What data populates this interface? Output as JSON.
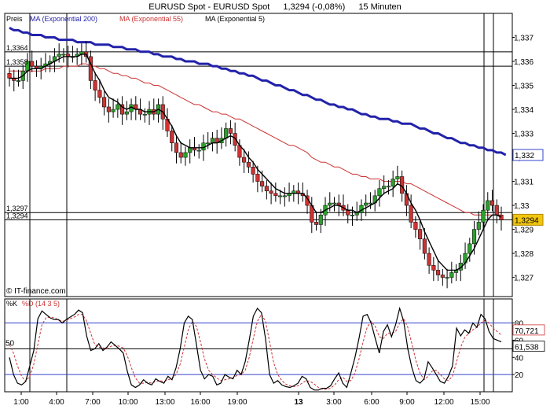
{
  "header": {
    "instrument": "EURUSD Spot - EURUSD Spot",
    "quote": "1,3294 (-0,08%)",
    "interval": "15 Minuten"
  },
  "chart_data": [
    {
      "type": "candlestick",
      "legend": [
        {
          "label": "Preis",
          "color": "#000000"
        },
        {
          "label": "MA (Exponential 200)",
          "color": "#2222aa"
        },
        {
          "label": "MA (Exponential 55)",
          "color": "#cc3333"
        },
        {
          "label": "MA (Exponential 5)",
          "color": "#000000"
        }
      ],
      "watermark": "© IT-finance.com",
      "ylim": [
        1.3262,
        1.338
      ],
      "y_ticks": [
        "1,337",
        "1,336",
        "1,335",
        "1,334",
        "1,333",
        "1,332",
        "1,331",
        "1,33",
        "1,329",
        "1,328",
        "1,327"
      ],
      "x_ticks": [
        "1:00",
        "4:00",
        "7:00",
        "10:00",
        "13:00",
        "16:00",
        "19:00",
        "13",
        "3:00",
        "6:00",
        "9:00",
        "12:00",
        "15:00"
      ],
      "h_levels": [
        {
          "label": "1,3364",
          "value": 1.3364
        },
        {
          "label": "1,3358",
          "value": 1.3358
        },
        {
          "label": "1,3297",
          "value": 1.3297
        },
        {
          "label": "1,3294",
          "value": 1.3294
        }
      ],
      "price_badges": [
        {
          "label": "1,332",
          "value": 1.3321,
          "style": "outline"
        },
        {
          "label": "1,3294",
          "value": 1.3294,
          "style": "filled"
        }
      ],
      "up_color": "#2e9e2e",
      "down_color": "#cc3333",
      "series": {
        "close": [
          1.3353,
          1.3352,
          1.3352,
          1.3356,
          1.336,
          1.3358,
          1.3357,
          1.3358,
          1.3359,
          1.336,
          1.3362,
          1.3363,
          1.3363,
          1.3362,
          1.3362,
          1.3363,
          1.3364,
          1.3362,
          1.3352,
          1.3348,
          1.3345,
          1.3341,
          1.3339,
          1.334,
          1.3342,
          1.3338,
          1.3339,
          1.3342,
          1.334,
          1.3338,
          1.3338,
          1.334,
          1.3338,
          1.3342,
          1.3336,
          1.3331,
          1.3326,
          1.3322,
          1.332,
          1.3322,
          1.3324,
          1.3323,
          1.3323,
          1.3326,
          1.3326,
          1.3328,
          1.3326,
          1.3328,
          1.3332,
          1.333,
          1.3325,
          1.332,
          1.3318,
          1.3316,
          1.3313,
          1.331,
          1.3308,
          1.3306,
          1.3305,
          1.3304,
          1.3304,
          1.3304,
          1.3305,
          1.3306,
          1.3305,
          1.3304,
          1.33,
          1.3293,
          1.3292,
          1.3296,
          1.33,
          1.3301,
          1.3301,
          1.33,
          1.3298,
          1.3296,
          1.3296,
          1.3297,
          1.33,
          1.3301,
          1.3301,
          1.3304,
          1.3307,
          1.3308,
          1.3308,
          1.3311,
          1.3312,
          1.3305,
          1.33,
          1.3293,
          1.329,
          1.3286,
          1.328,
          1.3275,
          1.3273,
          1.3271,
          1.327,
          1.327,
          1.3272,
          1.3273,
          1.3276,
          1.328,
          1.3284,
          1.329,
          1.3293,
          1.3298,
          1.3302,
          1.33,
          1.3296,
          1.3294
        ],
        "ema5": [
          1.3353,
          1.3353,
          1.3353,
          1.3354,
          1.3356,
          1.3357,
          1.3357,
          1.3357,
          1.3358,
          1.3359,
          1.336,
          1.3361,
          1.3362,
          1.3362,
          1.3362,
          1.3362,
          1.3363,
          1.3363,
          1.3359,
          1.3355,
          1.3352,
          1.3348,
          1.3345,
          1.3344,
          1.3343,
          1.3341,
          1.334,
          1.3341,
          1.334,
          1.334,
          1.3339,
          1.3339,
          1.3339,
          1.334,
          1.3339,
          1.3336,
          1.3333,
          1.3329,
          1.3326,
          1.3325,
          1.3324,
          1.3324,
          1.3324,
          1.3324,
          1.3325,
          1.3326,
          1.3326,
          1.3327,
          1.3328,
          1.3329,
          1.3328,
          1.3325,
          1.3323,
          1.332,
          1.3318,
          1.3315,
          1.3313,
          1.3311,
          1.3309,
          1.3307,
          1.3306,
          1.3305,
          1.3305,
          1.3305,
          1.3305,
          1.3305,
          1.3303,
          1.33,
          1.3297,
          1.3297,
          1.3298,
          1.3299,
          1.33,
          1.33,
          1.3299,
          1.3298,
          1.3298,
          1.3297,
          1.3298,
          1.3299,
          1.33,
          1.3301,
          1.3303,
          1.3305,
          1.3306,
          1.3307,
          1.3309,
          1.3308,
          1.3305,
          1.3301,
          1.3298,
          1.3294,
          1.3289,
          1.3285,
          1.3281,
          1.3277,
          1.3275,
          1.3273,
          1.3273,
          1.3273,
          1.3274,
          1.3276,
          1.3279,
          1.3282,
          1.3286,
          1.329,
          1.3294,
          1.3296,
          1.3296,
          1.3295
        ],
        "ema55": [
          1.3356,
          1.3356,
          1.3356,
          1.3356,
          1.3356,
          1.3356,
          1.3356,
          1.3356,
          1.3357,
          1.3357,
          1.3357,
          1.3357,
          1.3358,
          1.3358,
          1.3358,
          1.3358,
          1.3359,
          1.3359,
          1.3358,
          1.3358,
          1.3357,
          1.3357,
          1.3356,
          1.3355,
          1.3355,
          1.3354,
          1.3354,
          1.3353,
          1.3353,
          1.3352,
          1.3351,
          1.3351,
          1.335,
          1.335,
          1.3349,
          1.3348,
          1.3347,
          1.3346,
          1.3345,
          1.3344,
          1.3343,
          1.3342,
          1.3342,
          1.3341,
          1.334,
          1.3339,
          1.3339,
          1.3338,
          1.3338,
          1.3337,
          1.3336,
          1.3336,
          1.3335,
          1.3334,
          1.3333,
          1.3332,
          1.3331,
          1.333,
          1.3329,
          1.3328,
          1.3327,
          1.3326,
          1.3325,
          1.3325,
          1.3324,
          1.3323,
          1.3322,
          1.332,
          1.3319,
          1.3318,
          1.3318,
          1.3317,
          1.3316,
          1.3316,
          1.3315,
          1.3314,
          1.3313,
          1.3313,
          1.3312,
          1.3312,
          1.3311,
          1.3311,
          1.3311,
          1.331,
          1.331,
          1.331,
          1.331,
          1.331,
          1.3309,
          1.3309,
          1.3308,
          1.3307,
          1.3306,
          1.3305,
          1.3304,
          1.3303,
          1.3302,
          1.3301,
          1.33,
          1.3299,
          1.3298,
          1.3297,
          1.3297,
          1.3296,
          1.3296,
          1.3296,
          1.3296,
          1.3296,
          1.3296,
          1.3296
        ],
        "ema200": [
          1.3374,
          1.3373,
          1.3373,
          1.3372,
          1.3372,
          1.3371,
          1.3371,
          1.3371,
          1.337,
          1.337,
          1.337,
          1.3369,
          1.3369,
          1.3369,
          1.3369,
          1.3368,
          1.3368,
          1.3368,
          1.3368,
          1.3367,
          1.3367,
          1.3367,
          1.3367,
          1.3366,
          1.3366,
          1.3366,
          1.3365,
          1.3365,
          1.3365,
          1.3364,
          1.3364,
          1.3364,
          1.3363,
          1.3363,
          1.3362,
          1.3362,
          1.3362,
          1.3361,
          1.3361,
          1.336,
          1.336,
          1.336,
          1.3359,
          1.3359,
          1.3359,
          1.3358,
          1.3358,
          1.3357,
          1.3357,
          1.3356,
          1.3356,
          1.3355,
          1.3355,
          1.3354,
          1.3354,
          1.3353,
          1.3352,
          1.3352,
          1.3351,
          1.335,
          1.335,
          1.3349,
          1.3348,
          1.3348,
          1.3347,
          1.3346,
          1.3346,
          1.3345,
          1.3344,
          1.3344,
          1.3343,
          1.3342,
          1.3342,
          1.3341,
          1.3341,
          1.334,
          1.334,
          1.3339,
          1.3338,
          1.3338,
          1.3337,
          1.3337,
          1.3336,
          1.3336,
          1.3336,
          1.3335,
          1.3335,
          1.3334,
          1.3334,
          1.3334,
          1.3333,
          1.3332,
          1.3332,
          1.3331,
          1.333,
          1.333,
          1.3329,
          1.3328,
          1.3328,
          1.3327,
          1.3326,
          1.3326,
          1.3325,
          1.3325,
          1.3324,
          1.3324,
          1.3323,
          1.3323,
          1.3322,
          1.3322,
          1.3321
        ]
      }
    },
    {
      "type": "line",
      "legend": [
        {
          "label": "%K",
          "color": "#000000"
        },
        {
          "label": "%D (14 3 5)",
          "color": "#cc3333"
        }
      ],
      "ylim": [
        0,
        108
      ],
      "y_ticks": [
        "80",
        "60",
        "40",
        "20"
      ],
      "levels": [
        {
          "value": 80,
          "color": "#3344cc"
        },
        {
          "value": 50,
          "color": "#000000",
          "label": "50"
        },
        {
          "value": 20,
          "color": "#3344cc"
        }
      ],
      "value_badges": [
        "70,721",
        "61,538"
      ],
      "series": [
        {
          "name": "%K",
          "values": [
            40,
            20,
            10,
            8,
            12,
            30,
            48,
            85,
            94,
            90,
            86,
            84,
            84,
            80,
            84,
            87,
            90,
            95,
            92,
            65,
            48,
            50,
            56,
            48,
            52,
            58,
            54,
            50,
            45,
            24,
            8,
            5,
            8,
            14,
            10,
            8,
            15,
            12,
            10,
            18,
            14,
            28,
            50,
            80,
            88,
            84,
            55,
            25,
            15,
            20,
            18,
            8,
            10,
            20,
            17,
            15,
            25,
            20,
            35,
            60,
            88,
            97,
            92,
            62,
            20,
            10,
            13,
            8,
            6,
            5,
            7,
            10,
            18,
            15,
            5,
            2,
            2,
            4,
            4,
            7,
            15,
            22,
            10,
            5,
            22,
            40,
            62,
            88,
            90,
            80,
            62,
            45,
            70,
            78,
            64,
            78,
            97,
            82,
            50,
            28,
            13,
            10,
            15,
            35,
            28,
            20,
            12,
            10,
            18,
            30,
            74,
            65,
            72,
            68,
            80,
            75,
            90,
            85,
            70,
            62,
            60,
            58
          ]
        },
        {
          "name": "%D (14 3 5)",
          "values": [
            55,
            45,
            30,
            18,
            12,
            18,
            32,
            55,
            78,
            86,
            87,
            86,
            84,
            82,
            83,
            85,
            87,
            90,
            90,
            82,
            68,
            55,
            52,
            51,
            50,
            53,
            54,
            53,
            51,
            42,
            28,
            16,
            10,
            10,
            11,
            10,
            12,
            13,
            12,
            14,
            15,
            20,
            32,
            52,
            72,
            82,
            76,
            58,
            38,
            25,
            20,
            16,
            13,
            14,
            15,
            16,
            19,
            20,
            25,
            40,
            62,
            82,
            90,
            82,
            58,
            34,
            20,
            13,
            9,
            7,
            6,
            7,
            10,
            13,
            12,
            9,
            5,
            3,
            3,
            4,
            8,
            14,
            17,
            12,
            13,
            22,
            38,
            58,
            75,
            82,
            76,
            64,
            62,
            68,
            68,
            70,
            80,
            85,
            75,
            56,
            36,
            22,
            14,
            18,
            24,
            25,
            20,
            15,
            13,
            18,
            35,
            52,
            63,
            68,
            72,
            75,
            80,
            83,
            80,
            74,
            70,
            66
          ]
        }
      ]
    }
  ]
}
